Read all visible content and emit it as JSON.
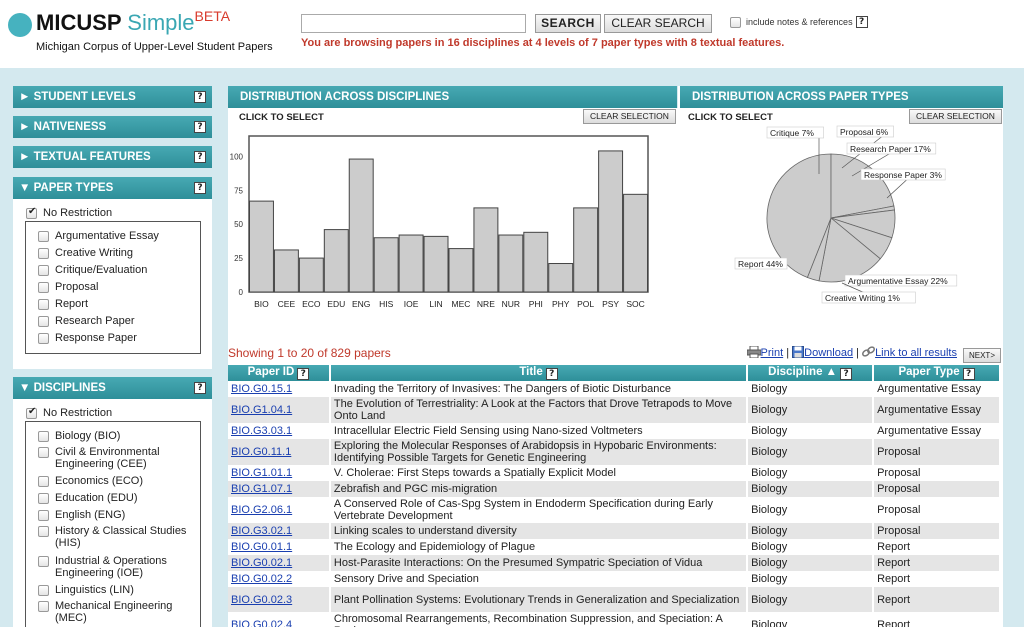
{
  "header": {
    "brand": "MICUSP",
    "brand_simple": "Simple",
    "brand_beta": "BETA",
    "subtitle": "Michigan Corpus of Upper-Level Student Papers",
    "search_placeholder": "",
    "search_label": "SEARCH",
    "clear_search_label": "CLEAR SEARCH",
    "include_notes_label": "include notes & references",
    "help_glyph": "?",
    "status": "You are browsing papers in 16 disciplines at 4 levels of 7 paper types with 8 textual features."
  },
  "sidebar": {
    "student_levels": "► STUDENT LEVELS",
    "nativeness": "► NATIVENESS",
    "textual_features": "► TEXTUAL FEATURES",
    "paper_types": {
      "title": "▼ PAPER TYPES",
      "no_restriction": "No Restriction",
      "items": [
        "Argumentative Essay",
        "Creative Writing",
        "Critique/Evaluation",
        "Proposal",
        "Report",
        "Research Paper",
        "Response Paper"
      ]
    },
    "disciplines": {
      "title": "▼ DISCIPLINES",
      "no_restriction": "No Restriction",
      "items": [
        [
          "Biology (BIO)"
        ],
        [
          "Civil & Environmental",
          "Engineering (CEE)"
        ],
        [
          "Economics (ECO)"
        ],
        [
          "Education (EDU)"
        ],
        [
          "English (ENG)"
        ],
        [
          "History & Classical Studies",
          "(HIS)"
        ],
        [
          "Industrial & Operations",
          "Engineering (IOE)"
        ],
        [
          "Linguistics (LIN)"
        ],
        [
          "Mechanical Engineering",
          "(MEC)"
        ]
      ]
    }
  },
  "disciplines_chart": {
    "heading": "DISTRIBUTION ACROSS DISCIPLINES",
    "click_label": "CLICK TO SELECT",
    "clear_label": "CLEAR SELECTION"
  },
  "paper_types_chart": {
    "heading": "DISTRIBUTION ACROSS PAPER TYPES",
    "click_label": "CLICK TO SELECT",
    "clear_label": "CLEAR SELECTION"
  },
  "chart_data": [
    {
      "type": "bar",
      "categories": [
        "BIO",
        "CEE",
        "ECO",
        "EDU",
        "ENG",
        "HIS",
        "IOE",
        "LIN",
        "MEC",
        "NRE",
        "NUR",
        "PHI",
        "PHY",
        "POL",
        "PSY",
        "SOC"
      ],
      "values": [
        67,
        31,
        25,
        46,
        98,
        40,
        42,
        41,
        32,
        62,
        42,
        44,
        21,
        62,
        104,
        72
      ],
      "yticks": [
        0,
        25,
        50,
        75,
        100
      ],
      "ylim": [
        0,
        115
      ],
      "grid": false,
      "bar_color": "#cccccc"
    },
    {
      "type": "pie",
      "slices": [
        {
          "label": "Report 44%",
          "value": 44
        },
        {
          "label": "Argumentative Essay 22%",
          "value": 22
        },
        {
          "label": "Creative Writing 1%",
          "value": 1
        },
        {
          "label": "Critique 7%",
          "value": 7
        },
        {
          "label": "Proposal 6%",
          "value": 6
        },
        {
          "label": "Research Paper 17%",
          "value": 17
        },
        {
          "label": "Response Paper 3%",
          "value": 3
        }
      ],
      "slice_color": "#cccccc"
    }
  ],
  "results": {
    "showing": "Showing 1 to 20 of 829 papers",
    "print_label": "Print",
    "download_label": "Download",
    "link_label": "Link to all results",
    "next_label": "NEXT>",
    "columns": {
      "paper_id": "Paper ID",
      "title": "Title",
      "discipline": "Discipline ▲",
      "paper_type": "Paper Type"
    },
    "rows": [
      {
        "id": "BIO.G0.15.1",
        "title": "Invading the Territory of Invasives: The Dangers of Biotic Disturbance",
        "discipline": "Biology",
        "type": "Argumentative Essay"
      },
      {
        "id": "BIO.G1.04.1",
        "title": "The Evolution of Terrestriality: A Look at the Factors that Drove Tetrapods to Move Onto Land",
        "discipline": "Biology",
        "type": "Argumentative Essay"
      },
      {
        "id": "BIO.G3.03.1",
        "title": "Intracellular Electric Field Sensing using Nano-sized Voltmeters",
        "discipline": "Biology",
        "type": "Argumentative Essay"
      },
      {
        "id": "BIO.G0.11.1",
        "title": "Exploring the Molecular Responses of Arabidopsis in Hypobaric Environments: Identifying Possible Targets for Genetic Engineering",
        "discipline": "Biology",
        "type": "Proposal"
      },
      {
        "id": "BIO.G1.01.1",
        "title": "V. Cholerae: First Steps towards a Spatially Explicit Model",
        "discipline": "Biology",
        "type": "Proposal"
      },
      {
        "id": "BIO.G1.07.1",
        "title": "Zebrafish and PGC mis-migration",
        "discipline": "Biology",
        "type": "Proposal"
      },
      {
        "id": "BIO.G2.06.1",
        "title": "A Conserved Role of Cas-Spg System in Endoderm Specification during Early Vertebrate Development",
        "discipline": "Biology",
        "type": "Proposal"
      },
      {
        "id": "BIO.G3.02.1",
        "title": "Linking scales to understand diversity",
        "discipline": "Biology",
        "type": "Proposal"
      },
      {
        "id": "BIO.G0.01.1",
        "title": "The Ecology and Epidemiology of Plague",
        "discipline": "Biology",
        "type": "Report"
      },
      {
        "id": "BIO.G0.02.1",
        "title": "Host-Parasite Interactions: On the Presumed Sympatric Speciation of Vidua",
        "discipline": "Biology",
        "type": "Report"
      },
      {
        "id": "BIO.G0.02.2",
        "title": "Sensory Drive and Speciation",
        "discipline": "Biology",
        "type": "Report"
      },
      {
        "id": "BIO.G0.02.3",
        "title": "Plant Pollination Systems: Evolutionary Trends in Generalization and Specialization",
        "discipline": "Biology",
        "type": "Report"
      },
      {
        "id": "BIO.G0.02.4",
        "title": "Chromosomal Rearrangements, Recombination Suppression, and Speciation: A Review",
        "discipline": "Biology",
        "type": "Report"
      }
    ]
  }
}
